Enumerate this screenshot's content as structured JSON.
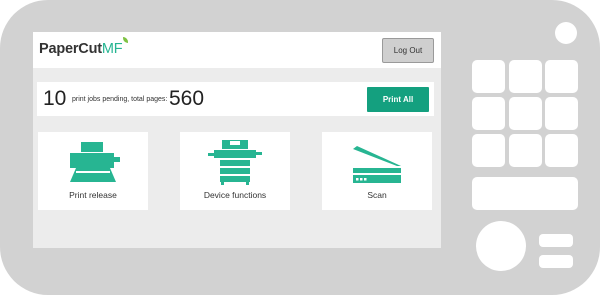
{
  "app": {
    "logo_main": "PaperCut",
    "logo_suffix": "MF",
    "logout_label": "Log Out"
  },
  "status": {
    "jobs_count": "10",
    "status_text": "print jobs pending, total pages:",
    "pages_count": "560",
    "print_all_label": "Print All"
  },
  "tiles": [
    {
      "label": "Print release",
      "icon": "printer-icon"
    },
    {
      "label": "Device functions",
      "icon": "copier-icon"
    },
    {
      "label": "Scan",
      "icon": "scanner-icon"
    }
  ],
  "colors": {
    "accent": "#14a07f",
    "device_body": "#d2d2d2",
    "screen_bg": "#ececec"
  }
}
